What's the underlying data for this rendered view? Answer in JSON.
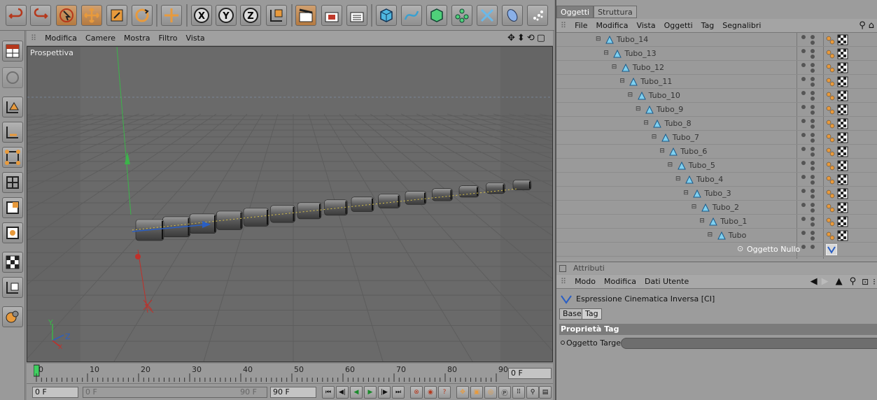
{
  "toolbar": {
    "icons": [
      "undo-icon",
      "redo-icon",
      "select-icon",
      "move-icon",
      "scale-icon",
      "rotate-icon",
      "move-alt-icon",
      "x-axis-icon",
      "y-axis-icon",
      "z-axis-icon",
      "coordinate-icon",
      "render-view-icon",
      "render-pv-icon",
      "render-settings-icon",
      "cube-icon",
      "spline-icon",
      "nurbs-icon",
      "array-icon",
      "deformer-icon",
      "scene-icon",
      "particle-icon"
    ]
  },
  "viewport": {
    "menu": [
      "Modifica",
      "Camere",
      "Mostra",
      "Filtro",
      "Vista"
    ],
    "label": "Prospettiva",
    "axis_labels": {
      "y": "Y",
      "z": "Z",
      "x": "X"
    }
  },
  "timeline": {
    "ticks": [
      "0",
      "10",
      "20",
      "30",
      "40",
      "50",
      "60",
      "70",
      "80",
      "90"
    ],
    "end_field": "0 F"
  },
  "playbar": {
    "current_frame": "0 F",
    "range_start": "0 F",
    "range_end": "90 F",
    "max_frame": "90 F"
  },
  "objects": {
    "tabs": [
      "Oggetti",
      "Struttura"
    ],
    "menu": [
      "File",
      "Modifica",
      "Vista",
      "Oggetti",
      "Tag",
      "Segnalibri"
    ],
    "items": [
      "Tubo_14",
      "Tubo_13",
      "Tubo_12",
      "Tubo_11",
      "Tubo_10",
      "Tubo_9",
      "Tubo_8",
      "Tubo_7",
      "Tubo_6",
      "Tubo_5",
      "Tubo_4",
      "Tubo_3",
      "Tubo_2",
      "Tubo_1",
      "Tubo"
    ],
    "null_item": "Oggetto Nullo"
  },
  "attributes": {
    "header": "Attributi",
    "menu": [
      "Modo",
      "Modifica",
      "Dati Utente"
    ],
    "title": "Espressione Cinematica Inversa [CI]",
    "subtabs": [
      "Base",
      "Tag"
    ],
    "section": "Proprietà Tag",
    "field_label": "Oggetto Target"
  },
  "colors": {
    "accent": "#e89a3c",
    "selected_text": "#ffffff",
    "grid": "#5f5f5f"
  }
}
